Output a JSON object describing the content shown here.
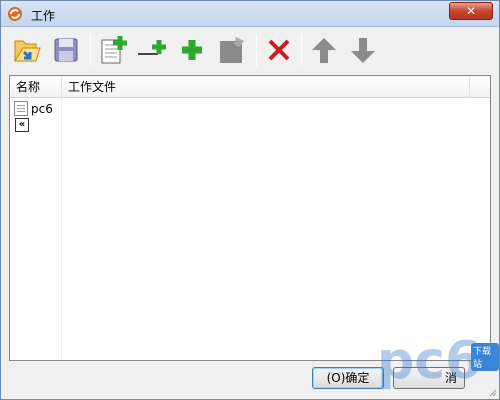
{
  "window": {
    "title": "工作",
    "close_symbol": "✕",
    "titlebar_color": "#c8daf0"
  },
  "toolbar": {
    "buttons": [
      {
        "icon": "folder-open-icon"
      },
      {
        "icon": "save-icon"
      },
      {
        "icon": "new-document-icon"
      },
      {
        "icon": "add-line-icon"
      },
      {
        "icon": "add-icon"
      },
      {
        "icon": "edit-page-icon"
      },
      {
        "icon": "delete-icon"
      },
      {
        "icon": "arrow-up-icon"
      },
      {
        "icon": "arrow-down-icon"
      }
    ]
  },
  "list": {
    "columns": [
      "名称",
      "工作文件"
    ],
    "rows": [
      {
        "name": "pc6",
        "file": ""
      }
    ],
    "collapse_label": "«"
  },
  "footer": {
    "ok_label": "(O)确定",
    "cancel_label": "消"
  },
  "watermark": {
    "text": "pc6",
    "tag": "下载站"
  }
}
